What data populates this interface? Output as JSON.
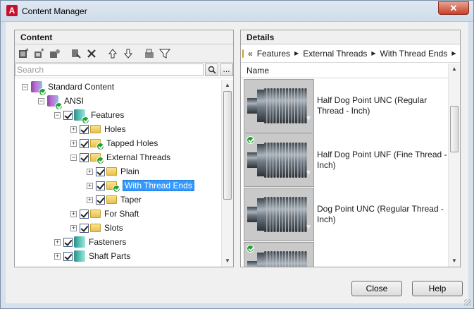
{
  "window": {
    "title": "Content Manager",
    "close_glyph": "✕",
    "app_icon_letter": "A"
  },
  "left_panel": {
    "header": "Content",
    "toolbar": [
      {
        "name": "add-category-icon"
      },
      {
        "name": "add-family-icon"
      },
      {
        "name": "edit-properties-icon"
      },
      {
        "name": "refresh-icon"
      },
      {
        "name": "delete-icon"
      },
      {
        "name": "move-up-icon"
      },
      {
        "name": "move-down-icon"
      },
      {
        "name": "open-file-icon"
      },
      {
        "name": "filter-icon"
      }
    ],
    "search": {
      "placeholder": "Search",
      "value": "",
      "more_label": "..."
    },
    "tree": [
      {
        "label": "Standard Content",
        "depth": 0,
        "expander": "-",
        "checkbox": false,
        "icon": "library",
        "installed": true
      },
      {
        "label": "ANSI",
        "depth": 1,
        "expander": "-",
        "checkbox": false,
        "icon": "library",
        "installed": true
      },
      {
        "label": "Features",
        "depth": 2,
        "expander": "-",
        "checkbox": true,
        "icon": "teal-book",
        "installed": true
      },
      {
        "label": "Holes",
        "depth": 3,
        "expander": "+",
        "checkbox": true,
        "icon": "folder",
        "installed": false
      },
      {
        "label": "Tapped Holes",
        "depth": 3,
        "expander": "+",
        "checkbox": true,
        "icon": "folder",
        "installed": true
      },
      {
        "label": "External Threads",
        "depth": 3,
        "expander": "-",
        "checkbox": true,
        "icon": "folder",
        "installed": true
      },
      {
        "label": "Plain",
        "depth": 4,
        "expander": "+",
        "checkbox": true,
        "icon": "folder",
        "installed": false
      },
      {
        "label": "With Thread Ends",
        "depth": 4,
        "expander": "+",
        "checkbox": true,
        "icon": "folder",
        "installed": true,
        "selected": true
      },
      {
        "label": "Taper",
        "depth": 4,
        "expander": "+",
        "checkbox": true,
        "icon": "folder",
        "installed": false
      },
      {
        "label": "For Shaft",
        "depth": 3,
        "expander": "+",
        "checkbox": true,
        "icon": "folder",
        "installed": false
      },
      {
        "label": "Slots",
        "depth": 3,
        "expander": "+",
        "checkbox": true,
        "icon": "folder",
        "installed": false
      },
      {
        "label": "Fasteners",
        "depth": 2,
        "expander": "+",
        "checkbox": true,
        "icon": "teal-book",
        "installed": false
      },
      {
        "label": "Shaft Parts",
        "depth": 2,
        "expander": "+",
        "checkbox": true,
        "icon": "teal-book",
        "installed": false
      }
    ]
  },
  "right_panel": {
    "header": "Details",
    "breadcrumb": {
      "back_glyph": "«",
      "items": [
        "Features",
        "External Threads",
        "With Thread Ends"
      ],
      "sep_glyph": "▶"
    },
    "column_header": "Name",
    "items": [
      {
        "label": "Half Dog Point UNC (Regular Thread - Inch)",
        "installed": false
      },
      {
        "label": "Half Dog Point UNF (Fine Thread - Inch)",
        "installed": true
      },
      {
        "label": "Dog Point UNC (Regular Thread - Inch)",
        "installed": false
      },
      {
        "label": "",
        "installed": true
      }
    ]
  },
  "footer": {
    "close_label": "Close",
    "help_label": "Help"
  },
  "colors": {
    "selection": "#3399ff",
    "installed_badge": "#1fa032",
    "close_button": "#c7402a"
  }
}
